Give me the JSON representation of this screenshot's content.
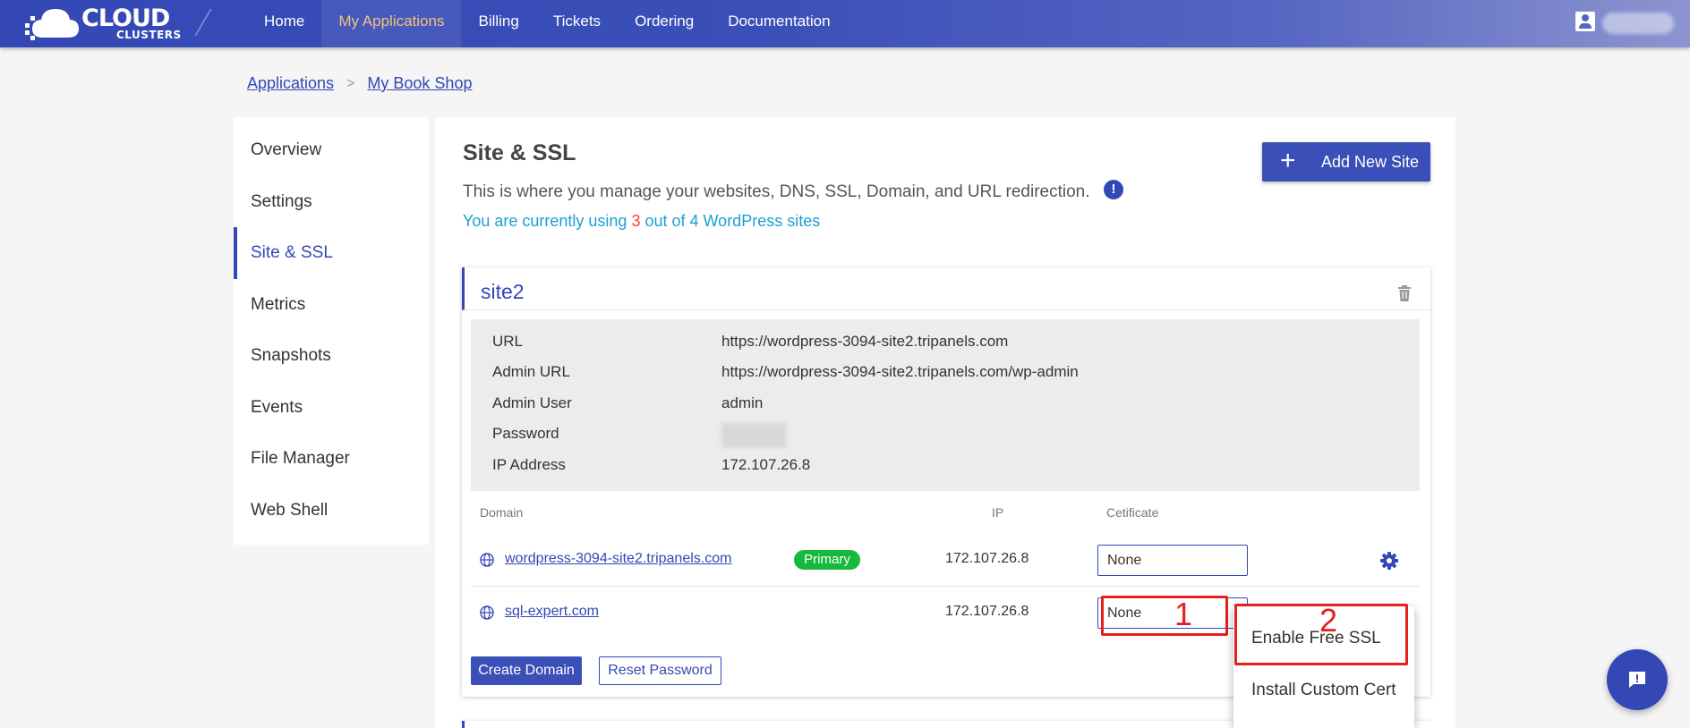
{
  "brand": {
    "logo_text": "CLOUD",
    "logo_sub": "CLUSTERS"
  },
  "nav": {
    "items": [
      {
        "label": "Home",
        "active": false
      },
      {
        "label": "My Applications",
        "active": true
      },
      {
        "label": "Billing",
        "active": false
      },
      {
        "label": "Tickets",
        "active": false
      },
      {
        "label": "Ordering",
        "active": false
      },
      {
        "label": "Documentation",
        "active": false
      }
    ]
  },
  "breadcrumb": {
    "root": "Applications",
    "separator": ">",
    "current": "My Book Shop"
  },
  "sidebar": {
    "items": [
      {
        "label": "Overview"
      },
      {
        "label": "Settings"
      },
      {
        "label": "Site & SSL",
        "active": true
      },
      {
        "label": "Metrics"
      },
      {
        "label": "Snapshots"
      },
      {
        "label": "Events"
      },
      {
        "label": "File Manager"
      },
      {
        "label": "Web Shell"
      }
    ]
  },
  "main": {
    "title": "Site & SSL",
    "description": "This is where you manage your websites, DNS, SSL, Domain, and URL redirection.",
    "info_icon": "!",
    "usage_prefix": "You are currently using ",
    "usage_used": "3",
    "usage_suffix": " out of 4 WordPress sites",
    "add_button": {
      "icon": "+",
      "label": "Add New Site"
    }
  },
  "site": {
    "name": "site2",
    "details": [
      {
        "label": "URL",
        "value": "https://wordpress-3094-site2.tripanels.com"
      },
      {
        "label": "Admin URL",
        "value": "https://wordpress-3094-site2.tripanels.com/wp-admin"
      },
      {
        "label": "Admin User",
        "value": "admin"
      },
      {
        "label": "Password",
        "value": ""
      },
      {
        "label": "IP Address",
        "value": "172.107.26.8"
      }
    ],
    "columns": {
      "domain": "Domain",
      "ip": "IP",
      "certificate": "Cetificate"
    },
    "domains": [
      {
        "domain": "wordpress-3094-site2.tripanels.com",
        "badge": "Primary",
        "ip": "172.107.26.8",
        "certificate": "None"
      },
      {
        "domain": "sql-expert.com",
        "badge": "",
        "ip": "172.107.26.8",
        "certificate": "None"
      }
    ],
    "create_domain": "Create Domain",
    "reset_password": "Reset Password"
  },
  "dropdown": {
    "items": [
      {
        "label": "Enable Free SSL"
      },
      {
        "label": "Install Custom Cert"
      }
    ]
  },
  "annotations": {
    "step1": "1",
    "step2": "2"
  },
  "colors": {
    "primary": "#3348b5",
    "accent_nav": "#f3c27b",
    "badge_green": "#17b83e",
    "annotation_red": "#e52020",
    "usage_blue": "#1a9fd6"
  }
}
